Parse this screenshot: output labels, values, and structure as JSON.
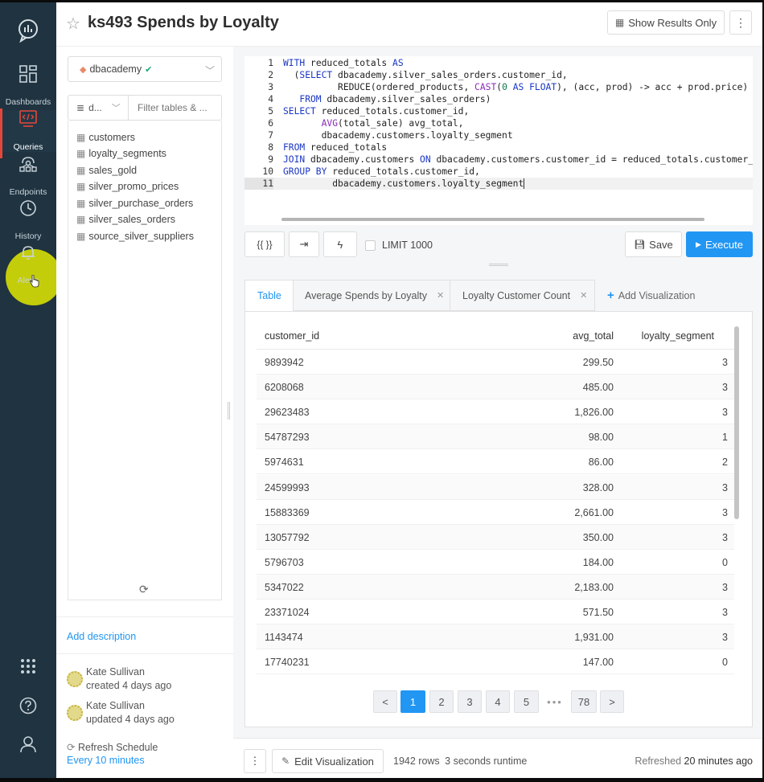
{
  "app": {
    "logo": "speech-chart-logo"
  },
  "nav": {
    "items": [
      {
        "label": "Dashboards",
        "icon": "dashboards-icon"
      },
      {
        "label": "Queries",
        "icon": "queries-icon"
      },
      {
        "label": "Endpoints",
        "icon": "endpoints-icon"
      },
      {
        "label": "History",
        "icon": "history-icon"
      },
      {
        "label": "Alerts",
        "icon": "alerts-icon"
      }
    ],
    "bottom": [
      "apps-grid-icon",
      "help-icon",
      "user-icon"
    ]
  },
  "header": {
    "title": "ks493 Spends by Loyalty",
    "show_results_label": "Show Results Only",
    "kebab": "⋮"
  },
  "schema": {
    "datasource": "dbacademy",
    "db_picker": "d...",
    "filter_placeholder": "Filter tables & ...",
    "tables": [
      "customers",
      "loyalty_segments",
      "sales_gold",
      "silver_promo_prices",
      "silver_purchase_orders",
      "silver_sales_orders",
      "source_silver_suppliers"
    ],
    "add_description": "Add description",
    "authors": [
      {
        "name": "Kate Sullivan",
        "when": "created 4 days ago"
      },
      {
        "name": "Kate Sullivan",
        "when": "updated 4 days ago"
      }
    ],
    "refresh_label": "Refresh Schedule",
    "refresh_value": "Every 10 minutes"
  },
  "editor": {
    "lines": [
      "WITH reduced_totals AS",
      "  (SELECT dbacademy.silver_sales_orders.customer_id,",
      "          REDUCE(ordered_products, CAST(0 AS FLOAT), (acc, prod) -> acc + prod.price) to",
      "   FROM dbacademy.silver_sales_orders)",
      "SELECT reduced_totals.customer_id,",
      "       AVG(total_sale) avg_total,",
      "       dbacademy.customers.loyalty_segment",
      "FROM reduced_totals",
      "JOIN dbacademy.customers ON dbacademy.customers.customer_id = reduced_totals.customer_i",
      "GROUP BY reduced_totals.customer_id,",
      "         dbacademy.customers.loyalty_segment"
    ],
    "current_line": 11,
    "toolbar": {
      "params_label": "{{ }}",
      "limit_label": "LIMIT 1000",
      "limit_checked": false,
      "save_label": "Save",
      "execute_label": "Execute"
    }
  },
  "results": {
    "tabs": [
      {
        "label": "Table"
      },
      {
        "label": "Average Spends by Loyalty"
      },
      {
        "label": "Loyalty Customer Count"
      }
    ],
    "add_viz_label": "Add Visualization",
    "columns": [
      "customer_id",
      "avg_total",
      "loyalty_segment"
    ],
    "rows": [
      [
        "9893942",
        "299.50",
        "3"
      ],
      [
        "6208068",
        "485.00",
        "3"
      ],
      [
        "29623483",
        "1,826.00",
        "3"
      ],
      [
        "54787293",
        "98.00",
        "1"
      ],
      [
        "5974631",
        "86.00",
        "2"
      ],
      [
        "24599993",
        "328.00",
        "3"
      ],
      [
        "15883369",
        "2,661.00",
        "3"
      ],
      [
        "13057792",
        "350.00",
        "3"
      ],
      [
        "5796703",
        "184.00",
        "0"
      ],
      [
        "5347022",
        "2,183.00",
        "3"
      ],
      [
        "23371024",
        "571.50",
        "3"
      ],
      [
        "1143474",
        "1,931.00",
        "3"
      ],
      [
        "17740231",
        "147.00",
        "0"
      ]
    ],
    "pagination": {
      "prev": "<",
      "pages": [
        "1",
        "2",
        "3",
        "4",
        "5"
      ],
      "ellipsis": "•••",
      "last": "78",
      "next": ">",
      "current": "1"
    }
  },
  "footer": {
    "kebab": "⋮",
    "edit_viz_label": "Edit Visualization",
    "rows_stat": "1942 rows",
    "runtime_stat": "3 seconds runtime",
    "refreshed_prefix": "Refreshed",
    "refreshed_value": "20 minutes ago"
  },
  "colors": {
    "accent": "#2196f3",
    "nav_bg": "#1f3340",
    "active_marker": "#e4473a",
    "highlight": "#e2e900"
  }
}
